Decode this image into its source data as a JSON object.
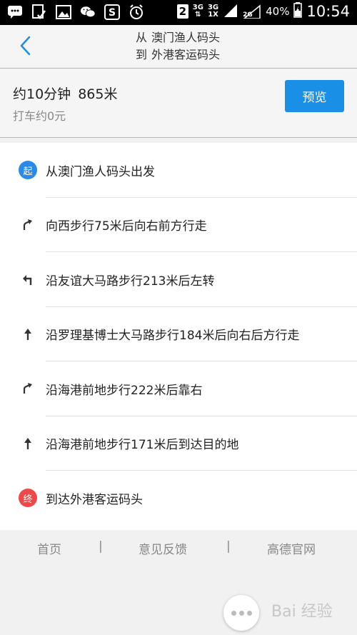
{
  "status_bar": {
    "icons": [
      "message-icon",
      "check-icon",
      "image-icon",
      "wechat-icon",
      "s-app-icon",
      "alarm-icon"
    ],
    "badge_number": "2",
    "network_a": "3G",
    "network_b_top": "3G",
    "network_b_bottom": "1X",
    "network_c": "2G",
    "battery": "40%",
    "time": "10:54"
  },
  "header": {
    "from_prefix": "从",
    "from_place": "澳门渔人码头",
    "to_prefix": "到",
    "to_place": "外港客运码头"
  },
  "summary": {
    "duration": "约10分钟",
    "distance": "865米",
    "taxi": "打车约0元",
    "preview_label": "预览"
  },
  "steps": [
    {
      "icon": "start-badge",
      "badge": "起",
      "text": "从澳门渔人码头出发"
    },
    {
      "icon": "turn-right-forward-icon",
      "text": "向西步行75米后向右前方行走"
    },
    {
      "icon": "turn-left-icon",
      "text": "沿友谊大马路步行213米后左转"
    },
    {
      "icon": "straight-arrow-icon",
      "text": "沿罗理基博士大马路步行184米后向右后方行走"
    },
    {
      "icon": "turn-right-forward-icon",
      "text": "沿海港前地步行222米后靠右"
    },
    {
      "icon": "straight-arrow-icon",
      "text": "沿海港前地步行171米后到达目的地"
    },
    {
      "icon": "end-badge",
      "badge": "终",
      "text": "到达外港客运码头"
    }
  ],
  "footer": {
    "links": [
      "首页",
      "意见反馈",
      "高德官网"
    ],
    "separator": "|"
  },
  "watermark": "Bai 经验",
  "colors": {
    "accent": "#1a8fe6",
    "start_badge": "#2a8ae8",
    "end_badge": "#f04848"
  }
}
